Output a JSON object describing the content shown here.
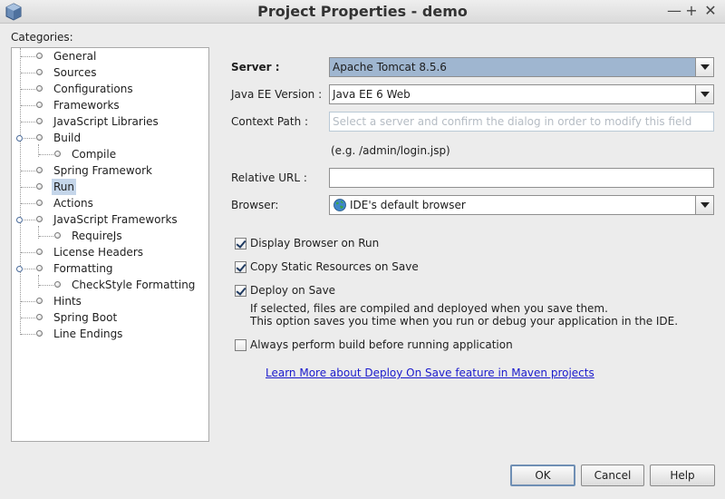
{
  "window": {
    "title": "Project Properties - demo",
    "controls": [
      "—",
      "+",
      "✕"
    ]
  },
  "categories_label": "Categories:",
  "tree": [
    {
      "label": "General",
      "level": 0
    },
    {
      "label": "Sources",
      "level": 0
    },
    {
      "label": "Configurations",
      "level": 0
    },
    {
      "label": "Frameworks",
      "level": 0
    },
    {
      "label": "JavaScript Libraries",
      "level": 0
    },
    {
      "label": "Build",
      "level": 0,
      "expanded": true
    },
    {
      "label": "Compile",
      "level": 1
    },
    {
      "label": "Spring Framework",
      "level": 0
    },
    {
      "label": "Run",
      "level": 0,
      "selected": true
    },
    {
      "label": "Actions",
      "level": 0
    },
    {
      "label": "JavaScript Frameworks",
      "level": 0,
      "expanded": true
    },
    {
      "label": "RequireJs",
      "level": 1
    },
    {
      "label": "License Headers",
      "level": 0
    },
    {
      "label": "Formatting",
      "level": 0,
      "expanded": true
    },
    {
      "label": "CheckStyle Formatting",
      "level": 1
    },
    {
      "label": "Hints",
      "level": 0
    },
    {
      "label": "Spring Boot",
      "level": 0
    },
    {
      "label": "Line Endings",
      "level": 0
    }
  ],
  "form": {
    "server_label": "Server :",
    "server_value": "Apache Tomcat 8.5.6",
    "javaee_label": "Java EE Version :",
    "javaee_value": "Java EE 6 Web",
    "context_label": "Context Path :",
    "context_placeholder": "Select a server and confirm the dialog in order to modify this field",
    "context_hint": "(e.g. /admin/login.jsp)",
    "relurl_label": "Relative URL :",
    "relurl_value": "",
    "browser_label": "Browser:",
    "browser_value": "IDE's default browser"
  },
  "options": {
    "display_browser": {
      "label": "Display Browser on Run",
      "checked": true
    },
    "copy_static": {
      "label": "Copy Static Resources on Save",
      "checked": true
    },
    "deploy_on_save": {
      "label": "Deploy on Save",
      "checked": true
    },
    "deploy_desc_1": "If selected, files are compiled and deployed when you save them.",
    "deploy_desc_2": "This option saves you time when you run or debug your application in the IDE.",
    "always_build": {
      "label": "Always perform build before running application",
      "checked": false
    },
    "learn_more_link": "Learn More about Deploy On Save feature in Maven projects"
  },
  "buttons": {
    "ok": "OK",
    "cancel": "Cancel",
    "help": "Help"
  },
  "colors": {
    "server_highlight": "#9fb6d0",
    "selection": "#c5d6ea",
    "link": "#1a1acc"
  }
}
